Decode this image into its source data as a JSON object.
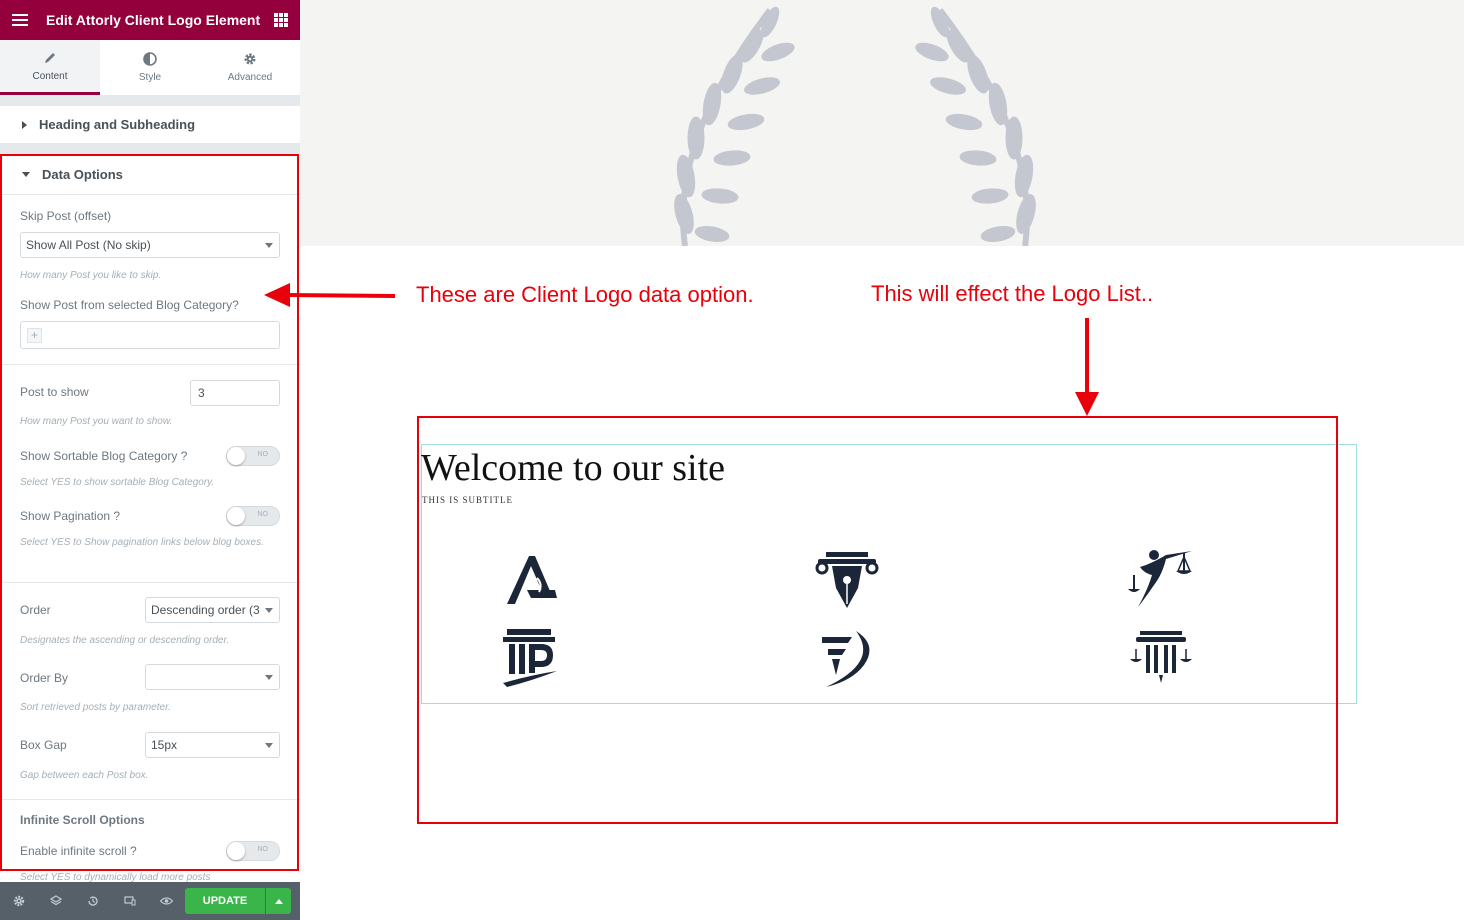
{
  "editor": {
    "title": "Edit Attorly Client Logo Element",
    "tabs": [
      {
        "label": "Content",
        "icon": "pencil-icon",
        "active": true
      },
      {
        "label": "Style",
        "icon": "half-circle-icon",
        "active": false
      },
      {
        "label": "Advanced",
        "icon": "gear-icon",
        "active": false
      }
    ],
    "sections": {
      "heading": "Heading and Subheading",
      "data_options": "Data Options"
    },
    "fields": {
      "skip_post": {
        "label": "Skip Post (offset)",
        "value": "Show All Post (No skip)",
        "desc": "How many Post you like to skip."
      },
      "category": {
        "label": "Show Post from selected Blog Category?",
        "placeholder": "+"
      },
      "post_to_show": {
        "label": "Post to show",
        "value": "3",
        "desc": "How many Post you want to show."
      },
      "sortable": {
        "label": "Show Sortable Blog Category ?",
        "state": "NO",
        "desc": "Select YES to show sortable Blog Category."
      },
      "pagination": {
        "label": "Show Pagination ?",
        "state": "NO",
        "desc": "Select YES to Show pagination links below blog boxes."
      },
      "order": {
        "label": "Order",
        "value": "Descending order (3",
        "desc": "Designates the ascending or descending order."
      },
      "order_by": {
        "label": "Order By",
        "value": "",
        "desc": "Sort retrieved posts by parameter."
      },
      "box_gap": {
        "label": "Box Gap",
        "value": "15px",
        "desc": "Gap between each Post box."
      },
      "infinite_heading": "Infinite Scroll Options",
      "infinite": {
        "label": "Enable infinite scroll ?",
        "state": "NO",
        "desc": "Select YES to dynamically load more posts"
      }
    },
    "footer": {
      "icons": [
        "gear-icon",
        "layers-icon",
        "history-icon",
        "responsive-icon",
        "eye-icon"
      ],
      "update_label": "UPDATE"
    },
    "accent_color": "#93003c",
    "update_color": "#39b54a"
  },
  "annotations": {
    "left": "These are Client Logo data option.",
    "right": "This will effect the Logo List..",
    "color": "#e8000b"
  },
  "preview": {
    "title": "Welcome to our site",
    "subtitle": "THIS IS SUBTITLE",
    "logos": [
      "letter-a-logo",
      "fountain-pen-column-logo",
      "justice-figure-logo",
      "column-p-logo",
      "swoosh-f-logo",
      "column-scales-logo"
    ]
  }
}
